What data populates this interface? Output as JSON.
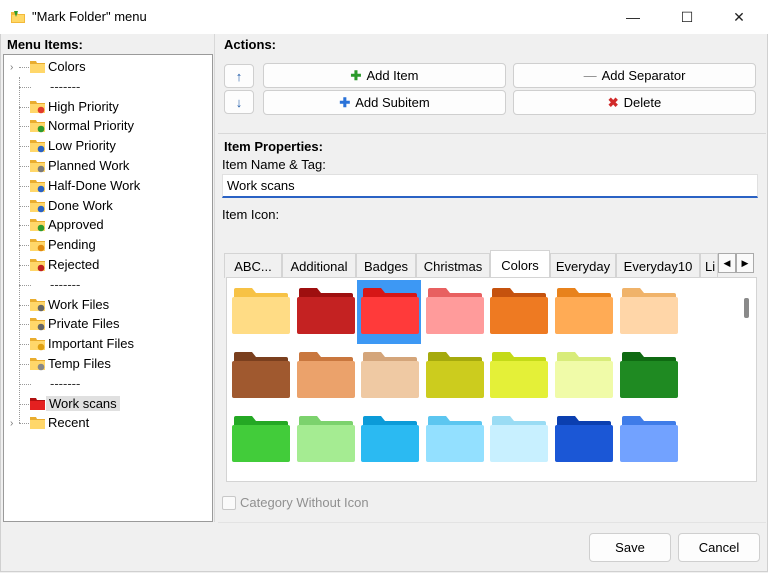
{
  "window": {
    "title": "\"Mark Folder\" menu",
    "minimize": "—",
    "maximize": "☐",
    "close": "✕"
  },
  "menu_items": {
    "header": "Menu Items:",
    "items": [
      {
        "label": "Colors",
        "icon": "folder-colors-icon",
        "expander": "›"
      },
      {
        "label": "-------",
        "icon": "",
        "separator": true
      },
      {
        "label": "High Priority",
        "icon": "folder-high-priority-icon"
      },
      {
        "label": "Normal Priority",
        "icon": "folder-normal-priority-icon"
      },
      {
        "label": "Low Priority",
        "icon": "folder-low-priority-icon"
      },
      {
        "label": "Planned Work",
        "icon": "folder-planned-work-icon"
      },
      {
        "label": "Half-Done Work",
        "icon": "folder-half-done-icon"
      },
      {
        "label": "Done Work",
        "icon": "folder-done-icon"
      },
      {
        "label": "Approved",
        "icon": "folder-approved-icon"
      },
      {
        "label": "Pending",
        "icon": "folder-pending-icon"
      },
      {
        "label": "Rejected",
        "icon": "folder-rejected-icon"
      },
      {
        "label": "-------",
        "icon": "",
        "separator": true
      },
      {
        "label": "Work Files",
        "icon": "folder-work-files-icon"
      },
      {
        "label": "Private Files",
        "icon": "folder-private-files-icon"
      },
      {
        "label": "Important Files",
        "icon": "folder-important-files-icon"
      },
      {
        "label": "Temp Files",
        "icon": "folder-temp-files-icon"
      },
      {
        "label": "-------",
        "icon": "",
        "separator": true
      },
      {
        "label": "Work scans",
        "icon": "folder-red-icon",
        "selected": true
      },
      {
        "label": "Recent",
        "icon": "folder-recent-icon",
        "expander": "›"
      }
    ]
  },
  "actions": {
    "header": "Actions:",
    "move_up": "↑",
    "move_down": "↓",
    "add_item": "Add Item",
    "add_separator": "Add Separator",
    "add_subitem": "Add Subitem",
    "delete": "Delete"
  },
  "properties": {
    "header": "Item Properties:",
    "name_label": "Item Name & Tag:",
    "name_value": "Work scans",
    "icon_label": "Item Icon:",
    "tabs": [
      "ABC...",
      "Additional",
      "Badges",
      "Christmas",
      "Colors",
      "Everyday",
      "Everyday10",
      "Li"
    ],
    "active_tab": "Colors",
    "tab_left": "◀",
    "tab_right": "▶",
    "category_without_icon": "Category Without Icon"
  },
  "gallery": {
    "selected_index": 2,
    "folders": [
      {
        "color": "#f7c245",
        "light": "#ffdc85"
      },
      {
        "color": "#9e0f0f",
        "light": "#c42222"
      },
      {
        "color": "#d61616",
        "light": "#ff3a3a"
      },
      {
        "color": "#e86060",
        "light": "#ff9b9b"
      },
      {
        "color": "#c5520e",
        "light": "#ee7a22"
      },
      {
        "color": "#e8821c",
        "light": "#ffab55"
      },
      {
        "color": "#f0b36a",
        "light": "#ffd6a8"
      },
      {
        "color": "#7a3f1e",
        "light": "#a0592f"
      },
      {
        "color": "#c9773e",
        "light": "#eba26b"
      },
      {
        "color": "#d4a57a",
        "light": "#efc9a3"
      },
      {
        "color": "#a5aa0d",
        "light": "#cccc1e"
      },
      {
        "color": "#c4da18",
        "light": "#e4f038"
      },
      {
        "color": "#d8ec7a",
        "light": "#f0fba8"
      },
      {
        "color": "#0f6a12",
        "light": "#1f8a22"
      },
      {
        "color": "#24a824",
        "light": "#42cc3a"
      },
      {
        "color": "#7cd26d",
        "light": "#a5ec92"
      },
      {
        "color": "#0b9bd8",
        "light": "#2bbaf2"
      },
      {
        "color": "#5cc6f0",
        "light": "#93e0ff"
      },
      {
        "color": "#9adcf4",
        "light": "#c8f0ff"
      },
      {
        "color": "#0b3fb0",
        "light": "#1b57d6"
      },
      {
        "color": "#3f7ce8",
        "light": "#72a2ff"
      }
    ]
  },
  "footer": {
    "save": "Save",
    "cancel": "Cancel"
  }
}
